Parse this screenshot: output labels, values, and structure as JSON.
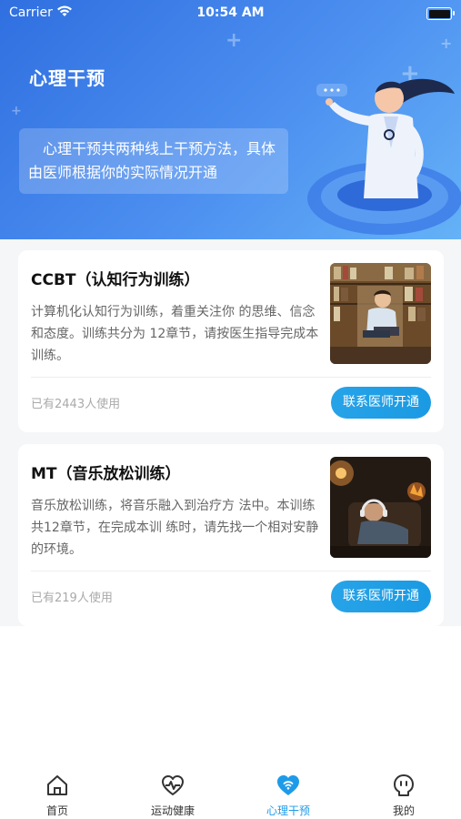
{
  "status_bar": {
    "carrier": "Carrier",
    "time": "10:54 AM"
  },
  "header": {
    "title": "心理干预",
    "description": "心理干预共两种线上干预方法，具体由医师根据你的实际情况开通"
  },
  "cards": [
    {
      "title": "CCBT（认知行为训练）",
      "description": "计算机化认知行为训练，着重关注你 的思维、信念和态度。训练共分为 12章节，请按医生指导完成本训练。",
      "users": "已有2443人使用",
      "button": "联系医师开通",
      "image_icon": "reading-student-photo"
    },
    {
      "title": "MT（音乐放松训练）",
      "description": "音乐放松训练，将音乐融入到治疗方 法中。本训练共12章节，在完成本训 练时，请先找一个相对安静的环境。",
      "users": "已有219人使用",
      "button": "联系医师开通",
      "image_icon": "headphones-relax-photo"
    }
  ],
  "tabbar": {
    "items": [
      {
        "label": "首页",
        "icon": "home-icon"
      },
      {
        "label": "运动健康",
        "icon": "heart-pulse-icon"
      },
      {
        "label": "心理干预",
        "icon": "heart-wifi-icon",
        "active": true
      },
      {
        "label": "我的",
        "icon": "face-icon"
      }
    ]
  },
  "colors": {
    "accent": "#1e9be8",
    "header_gradient_start": "#2f6fe0",
    "header_gradient_end": "#65b2f7"
  }
}
